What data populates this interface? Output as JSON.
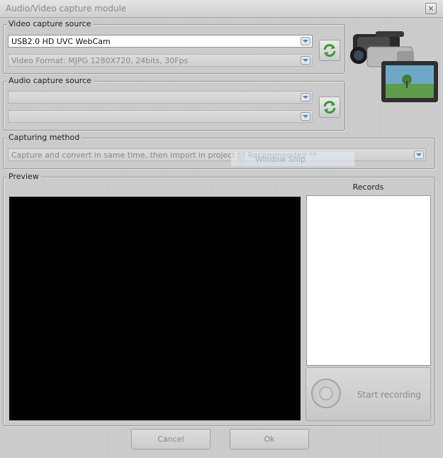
{
  "window": {
    "title": "Audio/Video capture module",
    "close": "×"
  },
  "video": {
    "legend": "Video capture source",
    "device": "USB2.0 HD UVC WebCam",
    "format": "Video Format: MJPG 1280X720, 24bits, 30Fps"
  },
  "audio": {
    "legend": "Audio capture source",
    "device": "",
    "format": ""
  },
  "capture": {
    "legend": "Capturing method",
    "method": "Capture and convert in same time, then import in project ** Recommended **",
    "overlay": "Window Snip"
  },
  "preview": {
    "legend": "Preview",
    "records_label": "Records",
    "records": []
  },
  "start_recording": "Start recording",
  "buttons": {
    "cancel": "Cancel",
    "ok": "Ok"
  },
  "icons": {
    "close": "close-icon",
    "dropdown": "chevron-down-icon",
    "refresh": "refresh-icon",
    "camera": "video-camera-icon",
    "record": "record-icon"
  },
  "colors": {
    "background": "#cbcbcb",
    "preview_bg": "#000000",
    "records_bg": "#ffffff",
    "refresh_green": "#3c9a34"
  }
}
